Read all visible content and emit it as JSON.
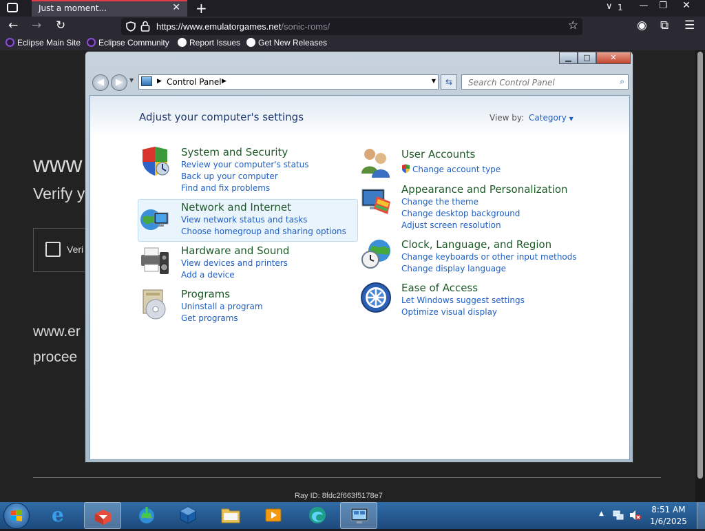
{
  "browser": {
    "tab_title": "Just a moment...",
    "tab_close": "✕",
    "new_tab": "+",
    "url_host": "https://www.emulatorgames.net",
    "url_path": "/sonic-roms/",
    "tab_count": "1",
    "bookmarks": [
      "Eclipse Main Site",
      "Eclipse Community",
      "Report Issues",
      "Get New Releases"
    ]
  },
  "page": {
    "heading_fragment": "www",
    "verify_fragment": "Verify y",
    "checkbox_label_fragment": "Veri",
    "line1_fragment": "www.er",
    "line2_fragment": "procee",
    "ray_id": "Ray ID: 8fdc2f663f5178e7"
  },
  "window": {
    "breadcrumb": "Control Panel",
    "search_placeholder": "Search Control Panel",
    "heading": "Adjust your computer's settings",
    "view_by_label": "View by:",
    "view_by_value": "Category",
    "categories_left": [
      {
        "title": "System and Security",
        "links": [
          "Review your computer's status",
          "Back up your computer",
          "Find and fix problems"
        ]
      },
      {
        "title": "Network and Internet",
        "links": [
          "View network status and tasks",
          "Choose homegroup and sharing options"
        ]
      },
      {
        "title": "Hardware and Sound",
        "links": [
          "View devices and printers",
          "Add a device"
        ]
      },
      {
        "title": "Programs",
        "links": [
          "Uninstall a program",
          "Get programs"
        ]
      }
    ],
    "categories_right": [
      {
        "title": "User Accounts",
        "links": [
          "Change account type"
        ]
      },
      {
        "title": "Appearance and Personalization",
        "links": [
          "Change the theme",
          "Change desktop background",
          "Adjust screen resolution"
        ]
      },
      {
        "title": "Clock, Language, and Region",
        "links": [
          "Change keyboards or other input methods",
          "Change display language"
        ]
      },
      {
        "title": "Ease of Access",
        "links": [
          "Let Windows suggest settings",
          "Optimize visual display"
        ]
      }
    ]
  },
  "taskbar": {
    "time": "8:51 AM",
    "date": "1/6/2025"
  }
}
